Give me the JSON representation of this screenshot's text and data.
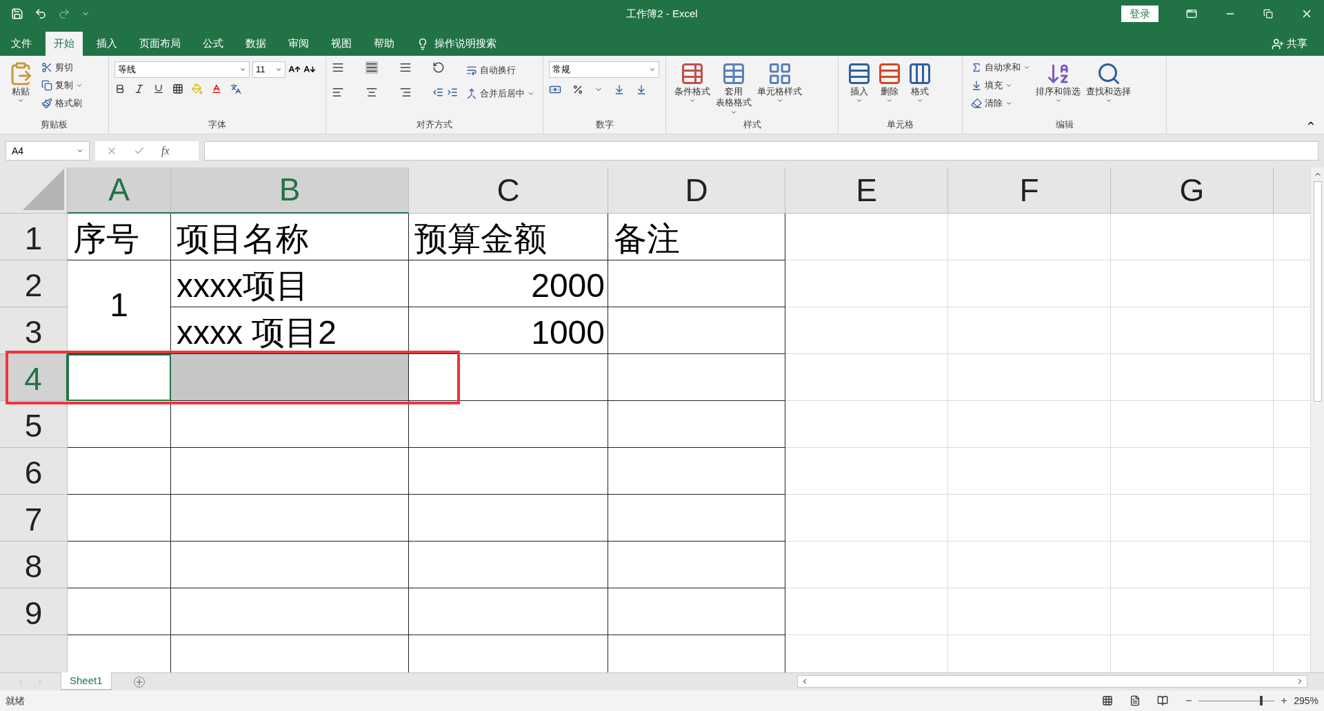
{
  "title_bar": {
    "title": "工作簿2 - Excel",
    "login": "登录"
  },
  "menu_tabs": [
    {
      "label": "文件",
      "selected": false
    },
    {
      "label": "开始",
      "selected": true
    },
    {
      "label": "插入",
      "selected": false
    },
    {
      "label": "页面布局",
      "selected": false
    },
    {
      "label": "公式",
      "selected": false
    },
    {
      "label": "数据",
      "selected": false
    },
    {
      "label": "审阅",
      "selected": false
    },
    {
      "label": "视图",
      "selected": false
    },
    {
      "label": "帮助",
      "selected": false
    }
  ],
  "tell_me": "操作说明搜索",
  "share": "共享",
  "ribbon": {
    "clipboard": {
      "label": "剪贴板",
      "paste": "粘贴",
      "cut": "剪切",
      "copy": "复制",
      "format_painter": "格式刷"
    },
    "font": {
      "label": "字体",
      "font_name": "等线",
      "font_size": "11"
    },
    "alignment": {
      "label": "对齐方式",
      "wrap": "自动换行",
      "merge": "合并后居中"
    },
    "number": {
      "label": "数字",
      "format": "常规"
    },
    "styles": {
      "label": "样式",
      "conditional": "条件格式",
      "table_line1": "套用",
      "table_line2": "表格格式",
      "cell_styles": "单元格样式"
    },
    "cells": {
      "label": "单元格",
      "insert": "插入",
      "delete": "删除",
      "format": "格式"
    },
    "editing": {
      "label": "编辑",
      "autosum": "自动求和",
      "fill": "填充",
      "clear": "清除",
      "sort": "排序和筛选",
      "find": "查找和选择"
    }
  },
  "formula_bar": {
    "name_box": "A4",
    "fx": "fx"
  },
  "columns": [
    {
      "label": "A",
      "selected": true,
      "bordered": true
    },
    {
      "label": "B",
      "selected": true,
      "bordered": true
    },
    {
      "label": "C",
      "selected": false,
      "bordered": true
    },
    {
      "label": "D",
      "selected": false,
      "bordered": true
    },
    {
      "label": "E",
      "selected": false,
      "bordered": false
    },
    {
      "label": "F",
      "selected": false,
      "bordered": false
    },
    {
      "label": "G",
      "selected": false,
      "bordered": false
    }
  ],
  "rows": [
    {
      "header": "1",
      "selected": false,
      "cells": [
        {
          "kind": "text",
          "text": "序号",
          "selected": false
        },
        {
          "kind": "text",
          "text": "项目名称",
          "selected": false
        },
        {
          "kind": "text",
          "text": "预算金额",
          "selected": false
        },
        {
          "kind": "text",
          "text": "备注",
          "selected": false
        },
        {
          "kind": "empty",
          "selected": false
        },
        {
          "kind": "empty",
          "selected": false
        },
        {
          "kind": "empty",
          "selected": false
        }
      ]
    },
    {
      "header": "2",
      "selected": false,
      "cells": [
        {
          "kind": "merged",
          "text": "1",
          "selected": false
        },
        {
          "kind": "text",
          "text": "xxxx项目",
          "selected": false
        },
        {
          "kind": "number",
          "text": "2000",
          "selected": false
        },
        {
          "kind": "empty",
          "selected": false
        },
        {
          "kind": "empty",
          "selected": false
        },
        {
          "kind": "empty",
          "selected": false
        },
        {
          "kind": "empty",
          "selected": false
        }
      ]
    },
    {
      "header": "3",
      "selected": false,
      "cells": [
        {
          "kind": "covered",
          "selected": false
        },
        {
          "kind": "text",
          "text": "xxxx 项目2",
          "selected": false
        },
        {
          "kind": "number",
          "text": "1000",
          "selected": false
        },
        {
          "kind": "empty",
          "selected": false
        },
        {
          "kind": "empty",
          "selected": false
        },
        {
          "kind": "empty",
          "selected": false
        },
        {
          "kind": "empty",
          "selected": false
        }
      ]
    },
    {
      "header": "4",
      "selected": true,
      "cells": [
        {
          "kind": "empty",
          "selected": true
        },
        {
          "kind": "empty",
          "selected": true
        },
        {
          "kind": "empty",
          "selected": false
        },
        {
          "kind": "empty",
          "selected": false
        },
        {
          "kind": "empty",
          "selected": false
        },
        {
          "kind": "empty",
          "selected": false
        },
        {
          "kind": "empty",
          "selected": false
        }
      ]
    },
    {
      "header": "5",
      "selected": false,
      "cells": [
        {
          "kind": "empty",
          "selected": false
        },
        {
          "kind": "empty",
          "selected": false
        },
        {
          "kind": "empty",
          "selected": false
        },
        {
          "kind": "empty",
          "selected": false
        },
        {
          "kind": "empty",
          "selected": false
        },
        {
          "kind": "empty",
          "selected": false
        },
        {
          "kind": "empty",
          "selected": false
        }
      ]
    },
    {
      "header": "6",
      "selected": false,
      "cells": [
        {
          "kind": "empty",
          "selected": false
        },
        {
          "kind": "empty",
          "selected": false
        },
        {
          "kind": "empty",
          "selected": false
        },
        {
          "kind": "empty",
          "selected": false
        },
        {
          "kind": "empty",
          "selected": false
        },
        {
          "kind": "empty",
          "selected": false
        },
        {
          "kind": "empty",
          "selected": false
        }
      ]
    },
    {
      "header": "7",
      "selected": false,
      "cells": [
        {
          "kind": "empty",
          "selected": false
        },
        {
          "kind": "empty",
          "selected": false
        },
        {
          "kind": "empty",
          "selected": false
        },
        {
          "kind": "empty",
          "selected": false
        },
        {
          "kind": "empty",
          "selected": false
        },
        {
          "kind": "empty",
          "selected": false
        },
        {
          "kind": "empty",
          "selected": false
        }
      ]
    },
    {
      "header": "8",
      "selected": false,
      "cells": [
        {
          "kind": "empty",
          "selected": false
        },
        {
          "kind": "empty",
          "selected": false
        },
        {
          "kind": "empty",
          "selected": false
        },
        {
          "kind": "empty",
          "selected": false
        },
        {
          "kind": "empty",
          "selected": false
        },
        {
          "kind": "empty",
          "selected": false
        },
        {
          "kind": "empty",
          "selected": false
        }
      ]
    },
    {
      "header": "9",
      "selected": false,
      "cells": [
        {
          "kind": "empty",
          "selected": false
        },
        {
          "kind": "empty",
          "selected": false
        },
        {
          "kind": "empty",
          "selected": false
        },
        {
          "kind": "empty",
          "selected": false
        },
        {
          "kind": "empty",
          "selected": false
        },
        {
          "kind": "empty",
          "selected": false
        },
        {
          "kind": "empty",
          "selected": false
        }
      ]
    }
  ],
  "sheet_tabs": [
    {
      "label": "Sheet1",
      "selected": true
    }
  ],
  "status_bar": {
    "status": "就绪",
    "zoom": "295%",
    "zoom_slider": {
      "level": 0.83
    }
  }
}
